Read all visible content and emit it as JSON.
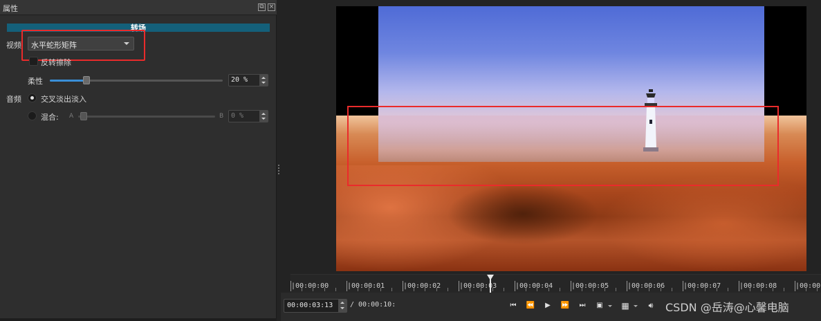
{
  "properties_panel": {
    "title": "属性",
    "transition_banner": "转场",
    "video_label": "视频",
    "video_transition_value": "水平蛇形矩阵",
    "invert_wipe_label": "反转擦除",
    "softness_label": "柔性",
    "softness_level_percent": 20,
    "softness_value": "20 %",
    "audio_label": "音频",
    "crossfade_label": "交叉淡出淡入",
    "mix_label": "混合:",
    "mix_a_label": "A",
    "mix_b_label": "B",
    "mix_level_percent": 0,
    "mix_value": "0 %"
  },
  "timeline": {
    "ruler_labels": [
      "|00:00:00",
      "|00:00:01",
      "|00:00:02",
      "|00:00:03",
      "|00:00:04",
      "|00:00:05",
      "|00:00:06",
      "|00:00:07",
      "|00:00:08",
      "|00:00:"
    ]
  },
  "transport": {
    "position": "00:00:03:13",
    "duration": "/ 00:00:10:",
    "buttons": [
      "skip-to-start",
      "rewind",
      "play",
      "fast-forward",
      "skip-to-end",
      "zoom",
      "grid",
      "volume"
    ]
  },
  "watermark": "CSDN @岳涛@心馨电脑",
  "colors": {
    "accent_blue": "#3a8fd8",
    "banner": "#14607a",
    "highlight_red": "#ea2b2b"
  }
}
